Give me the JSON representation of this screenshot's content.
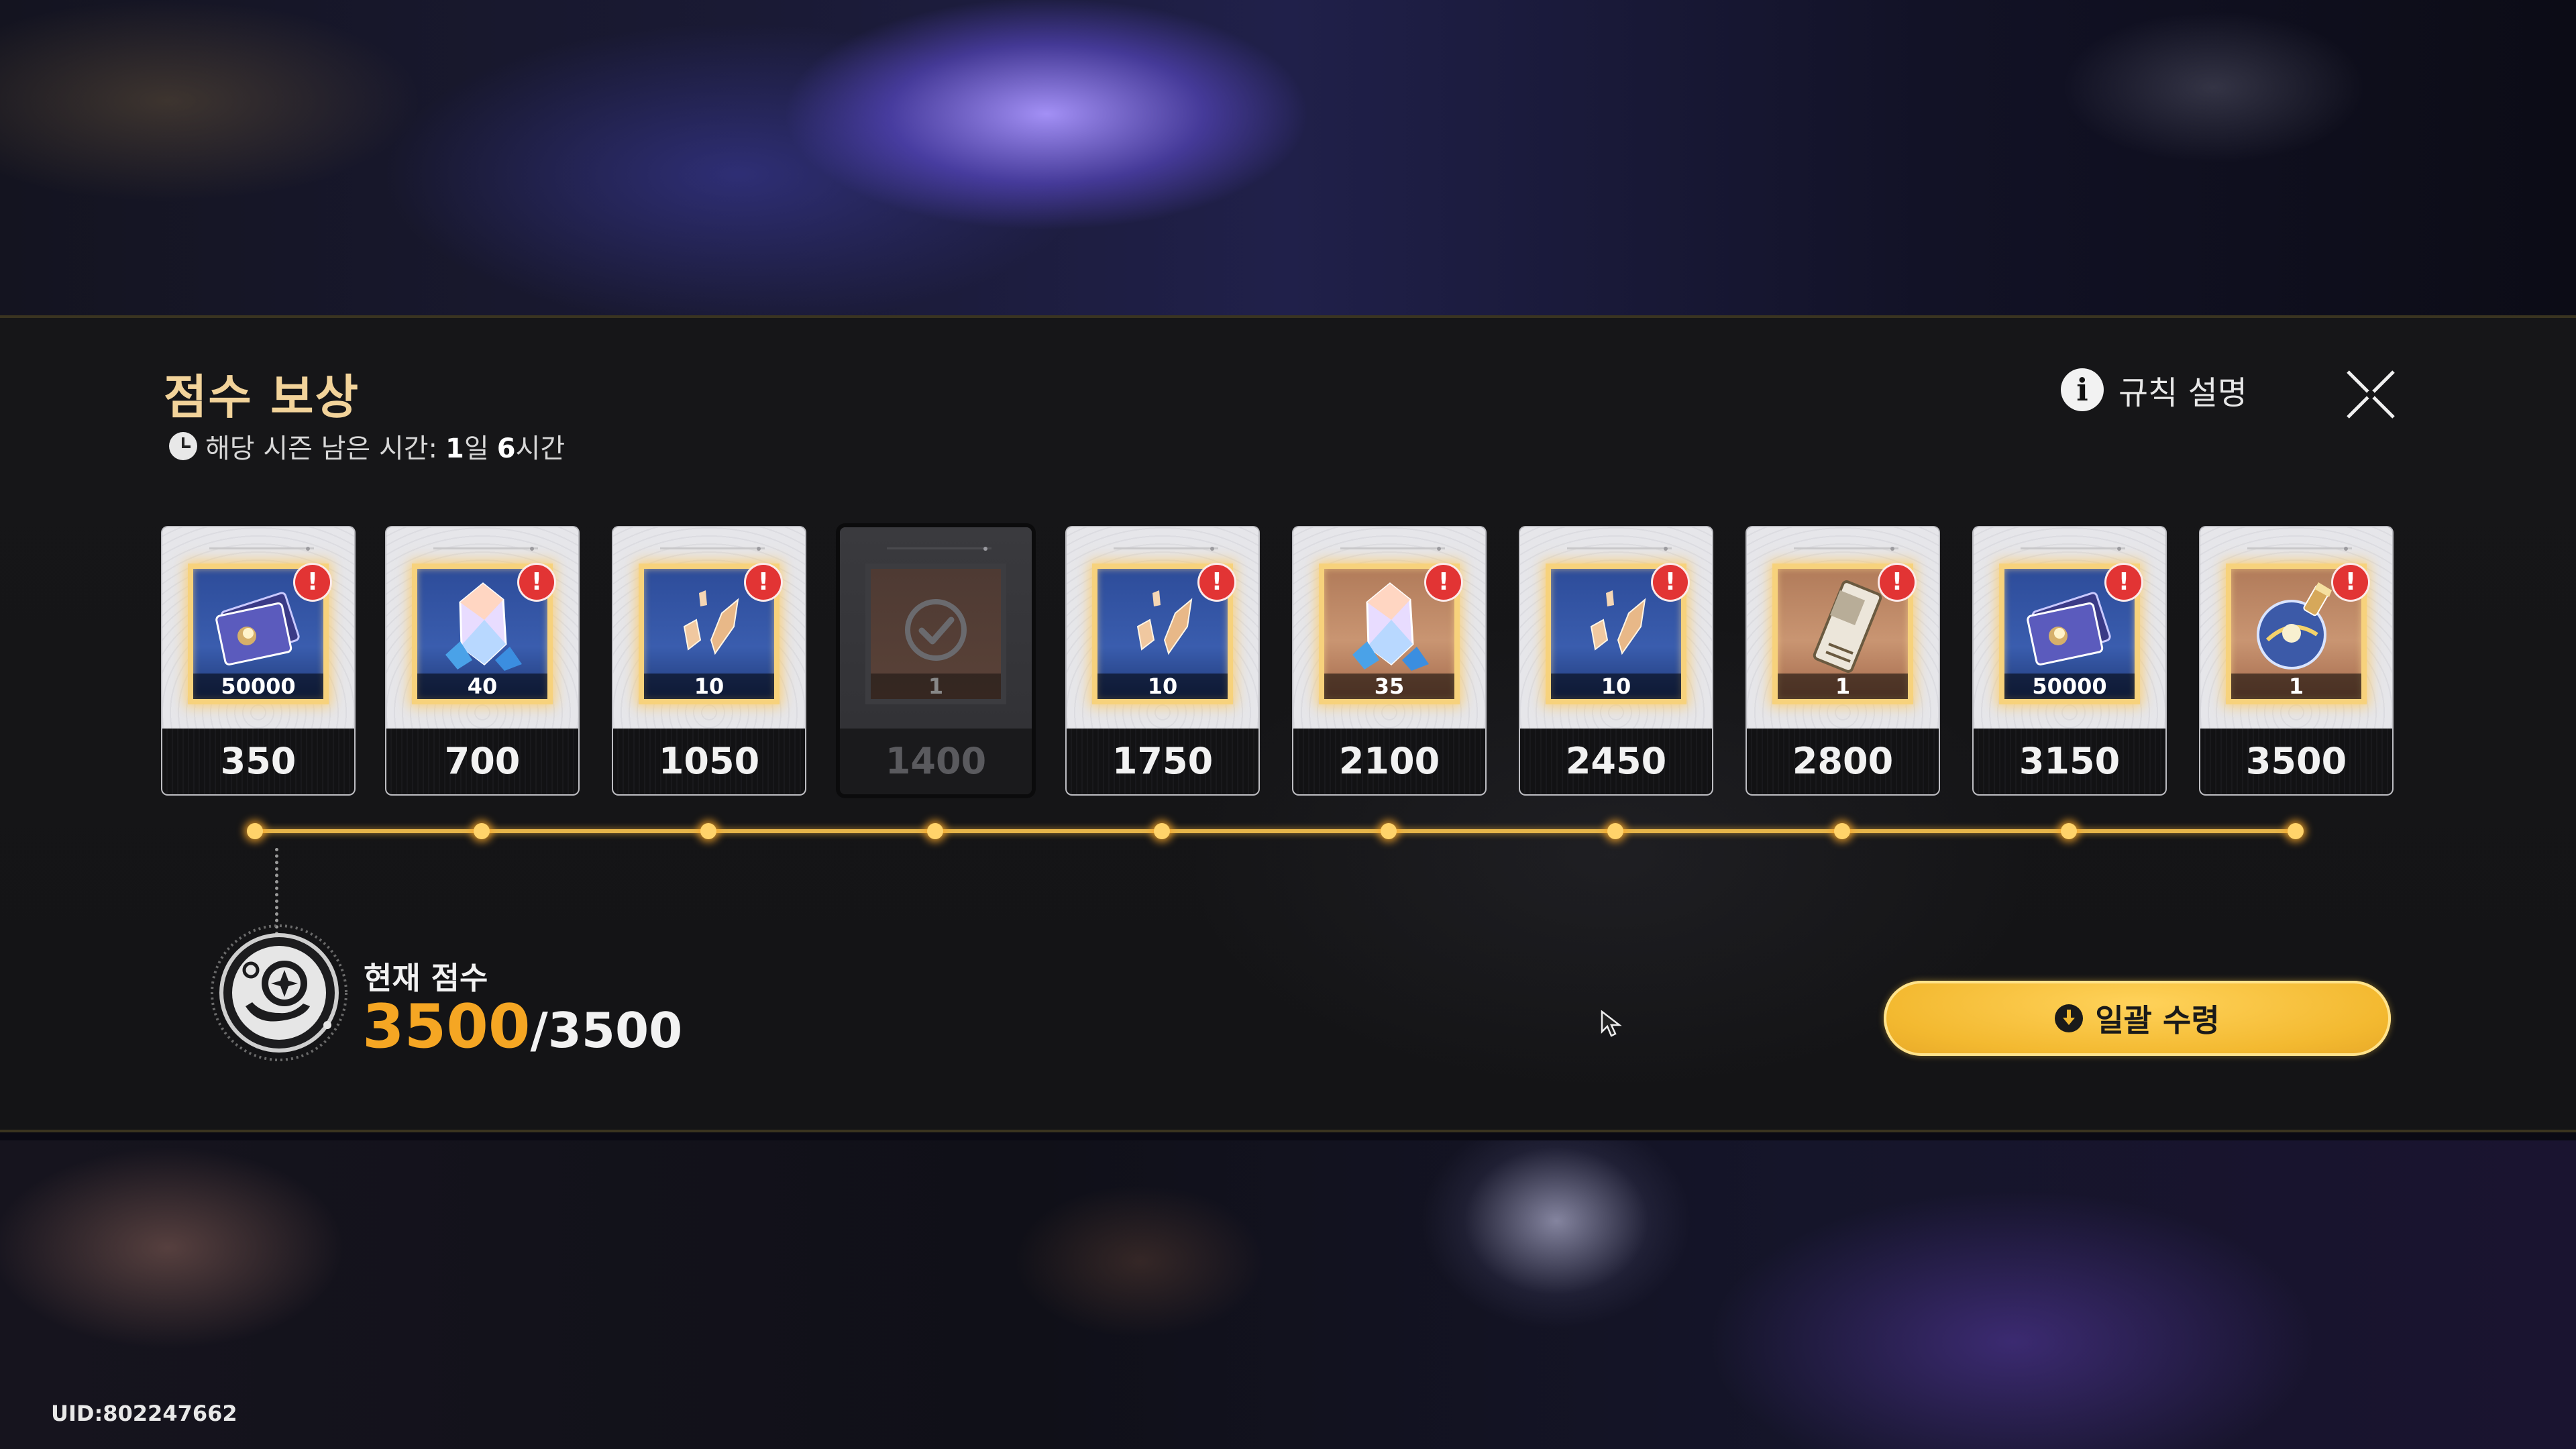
{
  "panel": {
    "title": "점수 보상",
    "season_label": "해당 시즌 남은 시간:",
    "season_days": "1",
    "season_days_unit": "일",
    "season_hours": "6",
    "season_hours_unit": "시간",
    "rules_label": "규칙 설명",
    "info_icon": "i"
  },
  "rewards": [
    {
      "score": "350",
      "qty": "50000",
      "item": "card-ticket-icon",
      "alert": "!",
      "claimed": false
    },
    {
      "score": "700",
      "qty": "40",
      "item": "crystal-icon",
      "alert": "!",
      "claimed": false
    },
    {
      "score": "1050",
      "qty": "10",
      "item": "shard-icon",
      "alert": "!",
      "claimed": false
    },
    {
      "score": "1400",
      "qty": "1",
      "item": "claimed-check-icon",
      "alert": "",
      "claimed": true
    },
    {
      "score": "1750",
      "qty": "10",
      "item": "shard-icon",
      "alert": "!",
      "claimed": false
    },
    {
      "score": "2100",
      "qty": "35",
      "item": "crystal-icon",
      "alert": "!",
      "claimed": false
    },
    {
      "score": "2450",
      "qty": "10",
      "item": "shard-icon",
      "alert": "!",
      "claimed": false
    },
    {
      "score": "2800",
      "qty": "1",
      "item": "ticket-icon",
      "alert": "!",
      "claimed": false
    },
    {
      "score": "3150",
      "qty": "50000",
      "item": "card-ticket-icon",
      "alert": "!",
      "claimed": false
    },
    {
      "score": "3500",
      "qty": "1",
      "item": "orb-icon",
      "alert": "!",
      "claimed": false
    }
  ],
  "progress": {
    "current": 3500,
    "max": 3500
  },
  "current_score": {
    "label": "현재 점수",
    "value": "3500",
    "total": "/3500"
  },
  "claim_all": {
    "label": "일괄 수령"
  },
  "footer": {
    "uid": "UID:802247662"
  },
  "colors": {
    "accent_gold": "#f2d39a",
    "score_orange": "#f5a623",
    "button_yellow": "#f3b930",
    "alert_red": "#e23434",
    "track_gold": "#e6b54a"
  }
}
